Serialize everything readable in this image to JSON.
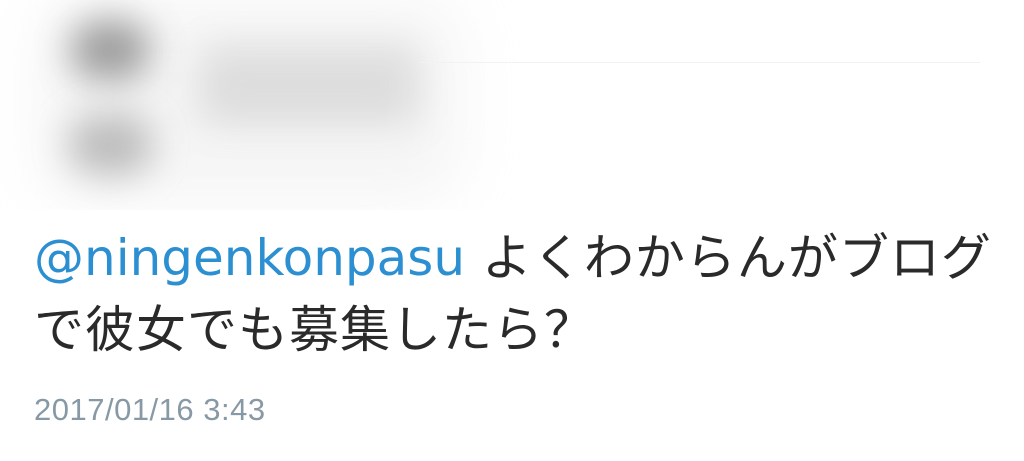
{
  "tweet": {
    "mention": "@ningenkonpasu",
    "text": " よくわからんがブログで彼女でも募集したら？",
    "timestamp": "2017/01/16 3:43"
  },
  "colors": {
    "mention": "#2b8fd1",
    "text": "#2a2a2a",
    "timestamp": "#8899a6",
    "background": "#ffffff"
  }
}
